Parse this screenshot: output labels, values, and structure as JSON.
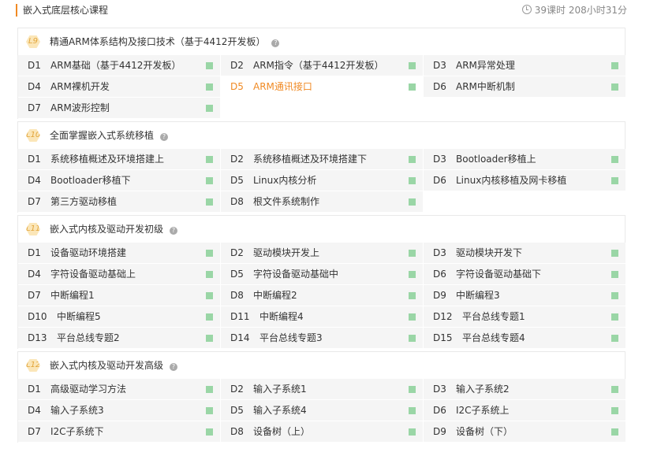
{
  "header": {
    "title": "嵌入式底层核心课程",
    "meta": "39课时 208小时31分"
  },
  "levels": [
    {
      "badge": "L9",
      "title": "精通ARM体系结构及接口技术（基于4412开发板）",
      "items": [
        {
          "d": "D1",
          "name": "ARM基础（基于4412开发板）"
        },
        {
          "d": "D2",
          "name": "ARM指令（基于4412开发板）"
        },
        {
          "d": "D3",
          "name": "ARM异常处理"
        },
        {
          "d": "D4",
          "name": "ARM裸机开发"
        },
        {
          "d": "D5",
          "name": "ARM通讯接口",
          "active": true
        },
        {
          "d": "D6",
          "name": "ARM中断机制"
        },
        {
          "d": "D7",
          "name": "ARM波形控制"
        }
      ]
    },
    {
      "badge": "L10",
      "title": "全面掌握嵌入式系统移植",
      "items": [
        {
          "d": "D1",
          "name": "系统移植概述及环境搭建上"
        },
        {
          "d": "D2",
          "name": "系统移植概述及环境搭建下"
        },
        {
          "d": "D3",
          "name": "Bootloader移植上"
        },
        {
          "d": "D4",
          "name": "Bootloader移植下"
        },
        {
          "d": "D5",
          "name": "Linux内核分析"
        },
        {
          "d": "D6",
          "name": "Linux内核移植及网卡移植"
        },
        {
          "d": "D7",
          "name": "第三方驱动移植"
        },
        {
          "d": "D8",
          "name": "根文件系统制作"
        }
      ]
    },
    {
      "badge": "L11",
      "title": "嵌入式内核及驱动开发初级",
      "items": [
        {
          "d": "D1",
          "name": "设备驱动环境搭建"
        },
        {
          "d": "D2",
          "name": "驱动模块开发上"
        },
        {
          "d": "D3",
          "name": "驱动模块开发下"
        },
        {
          "d": "D4",
          "name": "字符设备驱动基础上"
        },
        {
          "d": "D5",
          "name": "字符设备驱动基础中"
        },
        {
          "d": "D6",
          "name": "字符设备驱动基础下"
        },
        {
          "d": "D7",
          "name": "中断编程1"
        },
        {
          "d": "D8",
          "name": "中断编程2"
        },
        {
          "d": "D9",
          "name": "中断编程3"
        },
        {
          "d": "D10",
          "name": "中断编程5"
        },
        {
          "d": "D11",
          "name": "中断编程4"
        },
        {
          "d": "D12",
          "name": "平台总线专题1"
        },
        {
          "d": "D13",
          "name": "平台总线专题2"
        },
        {
          "d": "D14",
          "name": "平台总线专题3"
        },
        {
          "d": "D15",
          "name": "平台总线专题4"
        }
      ]
    },
    {
      "badge": "L12",
      "title": "嵌入式内核及驱动开发高级",
      "items": [
        {
          "d": "D1",
          "name": "高级驱动学习方法"
        },
        {
          "d": "D2",
          "name": "输入子系统1"
        },
        {
          "d": "D3",
          "name": "输入子系统2"
        },
        {
          "d": "D4",
          "name": "输入子系统3"
        },
        {
          "d": "D5",
          "name": "输入子系统4"
        },
        {
          "d": "D6",
          "name": "I2C子系统上"
        },
        {
          "d": "D7",
          "name": "I2C子系统下"
        },
        {
          "d": "D8",
          "name": "设备树（上）"
        },
        {
          "d": "D9",
          "name": "设备树（下）"
        }
      ]
    }
  ]
}
